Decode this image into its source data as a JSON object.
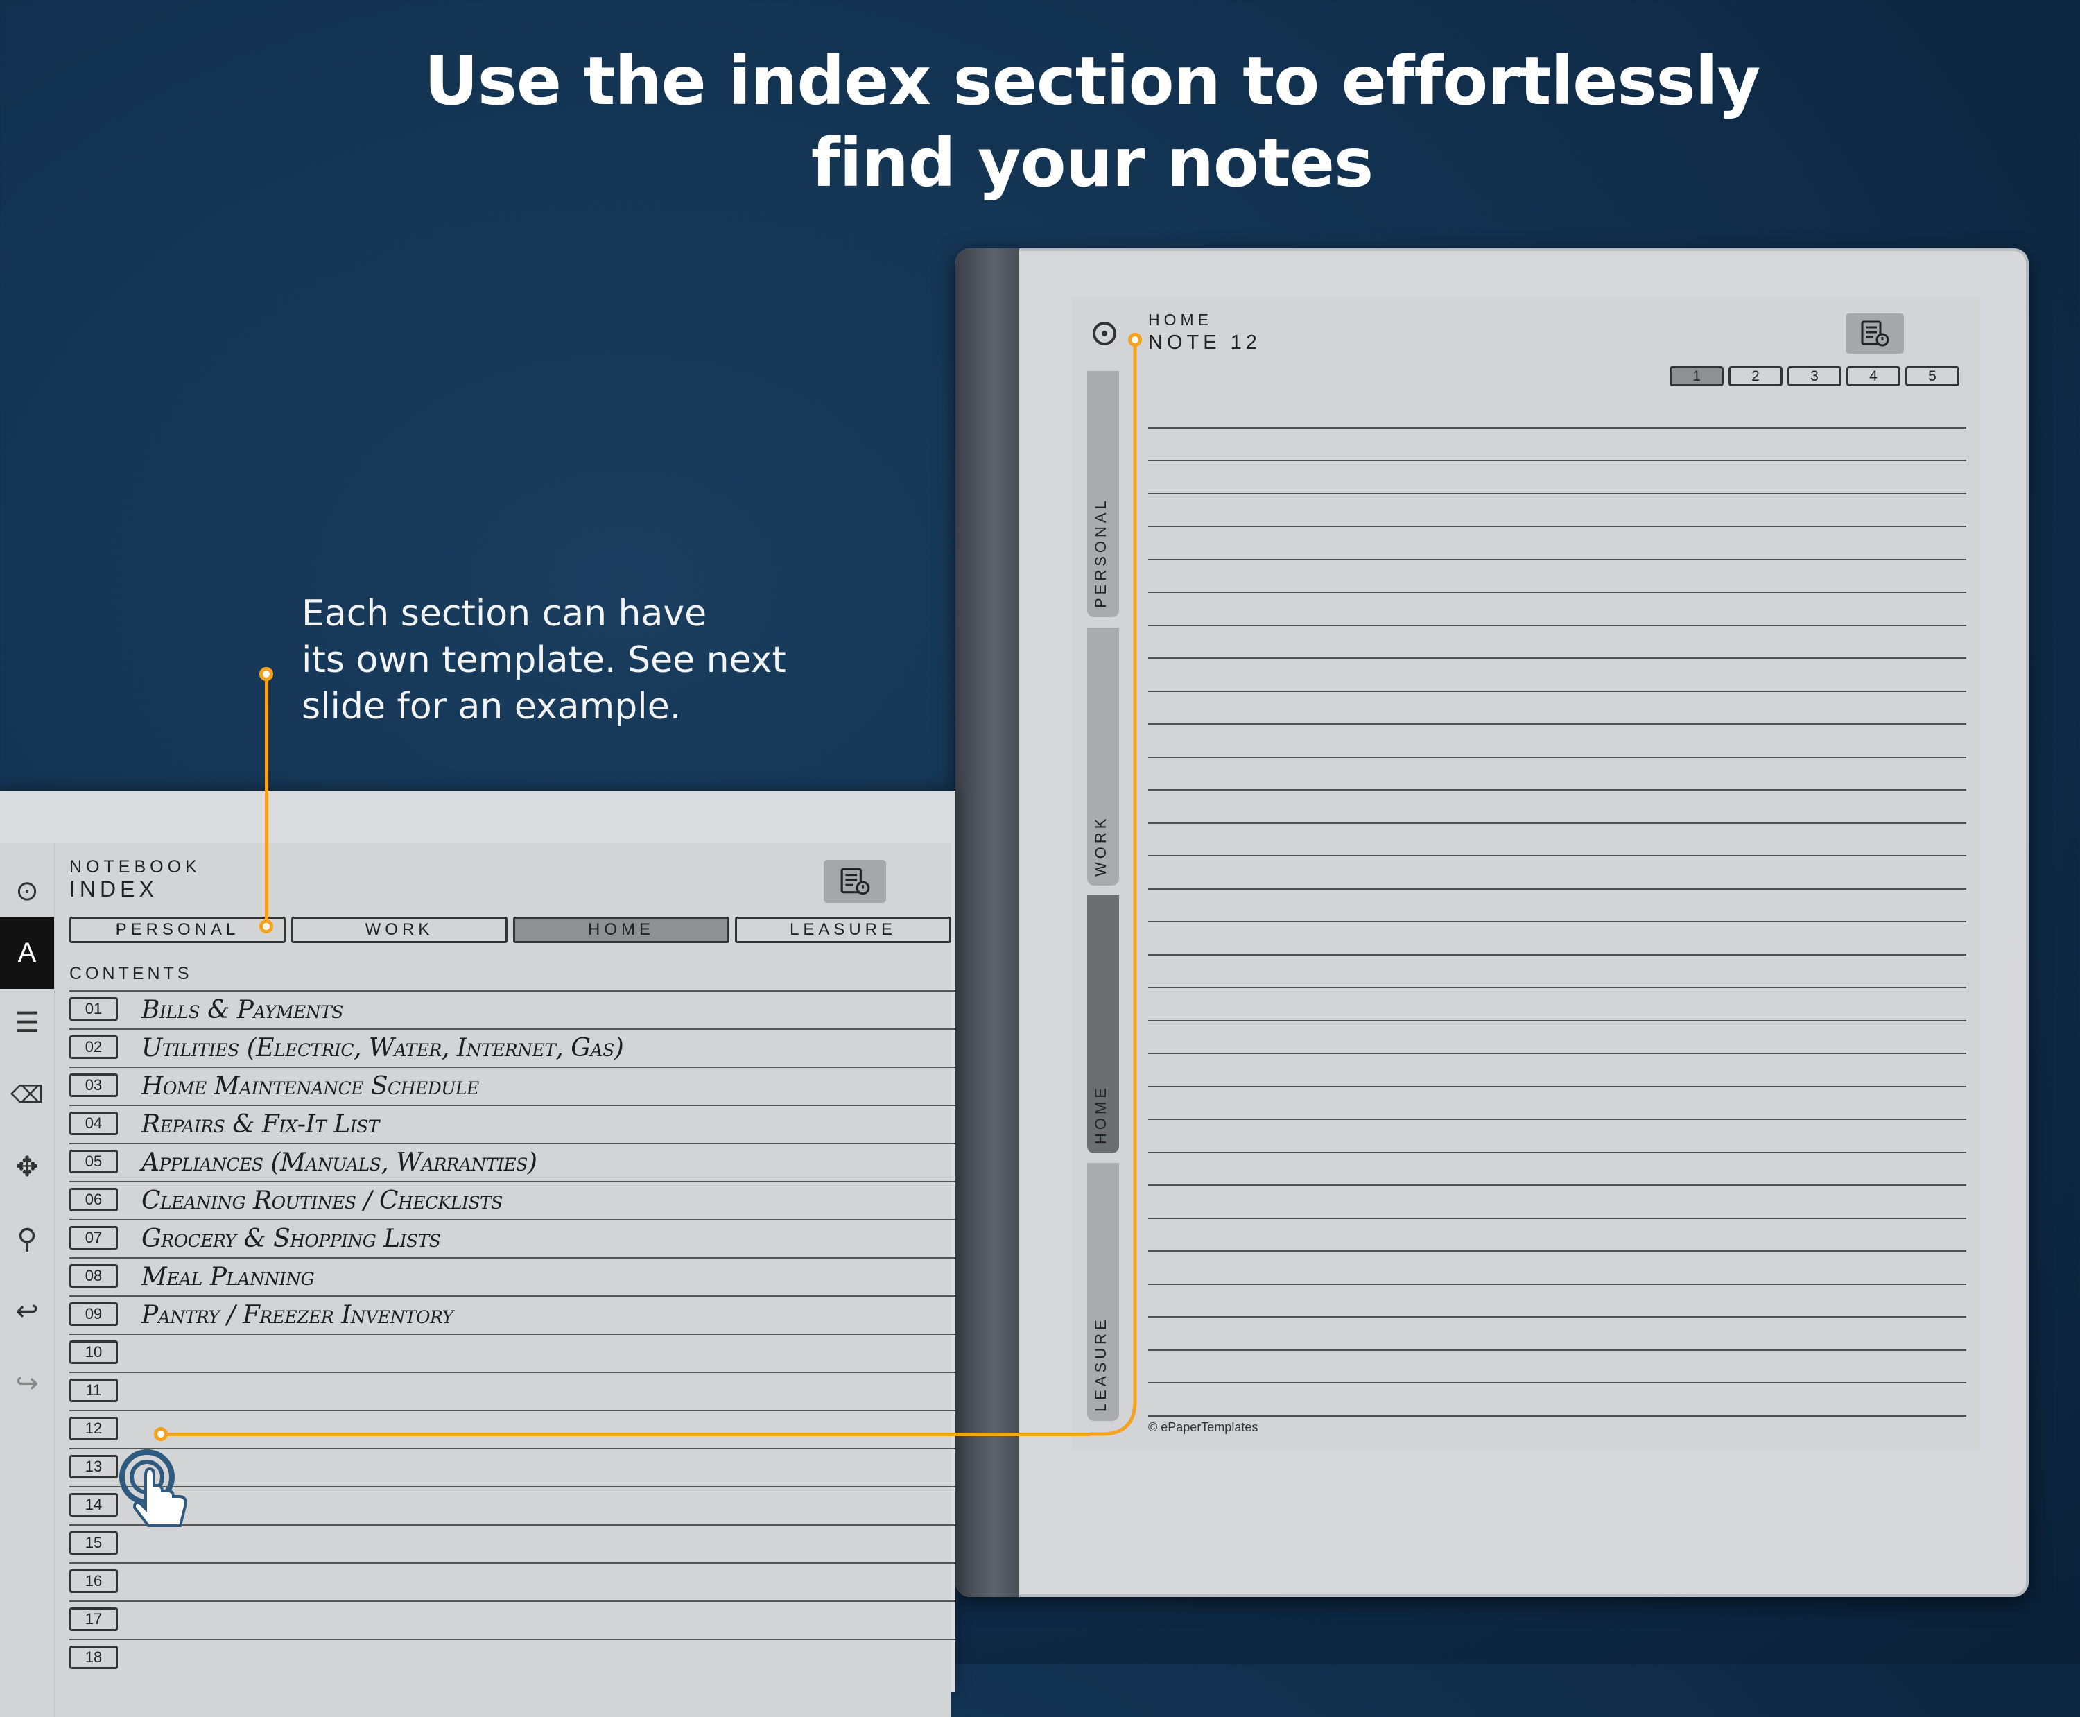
{
  "headline": {
    "line1": "Use the index section to effortlessly",
    "line2": "find your notes"
  },
  "callout": {
    "line1": "Each section can have",
    "line2": "its own template. See next",
    "line3": "slide for an example."
  },
  "colors": {
    "accent": "#f5a21c",
    "background": "#123150",
    "screen": "#d3d4d5",
    "active_tab": "#8e9092"
  },
  "right_page": {
    "section_label": "HOME",
    "title": "NOTE 12",
    "pages": [
      "1",
      "2",
      "3",
      "4",
      "5"
    ],
    "active_page": "1",
    "side_tabs": [
      "PERSONAL",
      "WORK",
      "HOME",
      "LEASURE"
    ],
    "active_side_tab": "HOME",
    "copyright": "© ePaperTemplates"
  },
  "left_page": {
    "section_label": "NOTEBOOK",
    "title": "INDEX",
    "tabs": [
      "PERSONAL",
      "WORK",
      "HOME",
      "LEASURE"
    ],
    "active_tab": "HOME",
    "contents_label": "CONTENTS",
    "rows": [
      {
        "num": "01",
        "text": "Bills & Payments"
      },
      {
        "num": "02",
        "text": "Utilities (Electric, Water, Internet, Gas)"
      },
      {
        "num": "03",
        "text": "Home Maintenance Schedule"
      },
      {
        "num": "04",
        "text": "Repairs & Fix-It List"
      },
      {
        "num": "05",
        "text": "Appliances (Manuals, Warranties)"
      },
      {
        "num": "06",
        "text": "Cleaning Routines / Checklists"
      },
      {
        "num": "07",
        "text": "Grocery & Shopping Lists"
      },
      {
        "num": "08",
        "text": "Meal Planning"
      },
      {
        "num": "09",
        "text": "Pantry / Freezer Inventory"
      },
      {
        "num": "10",
        "text": ""
      },
      {
        "num": "11",
        "text": ""
      },
      {
        "num": "12",
        "text": ""
      },
      {
        "num": "13",
        "text": ""
      },
      {
        "num": "14",
        "text": ""
      },
      {
        "num": "15",
        "text": ""
      },
      {
        "num": "16",
        "text": ""
      },
      {
        "num": "17",
        "text": ""
      },
      {
        "num": "18",
        "text": ""
      }
    ],
    "toolbar_icons": [
      "target-icon",
      "pen-icon",
      "menu-icon",
      "eraser-icon",
      "move-icon",
      "zoom-icon",
      "undo-icon",
      "redo-icon"
    ]
  }
}
